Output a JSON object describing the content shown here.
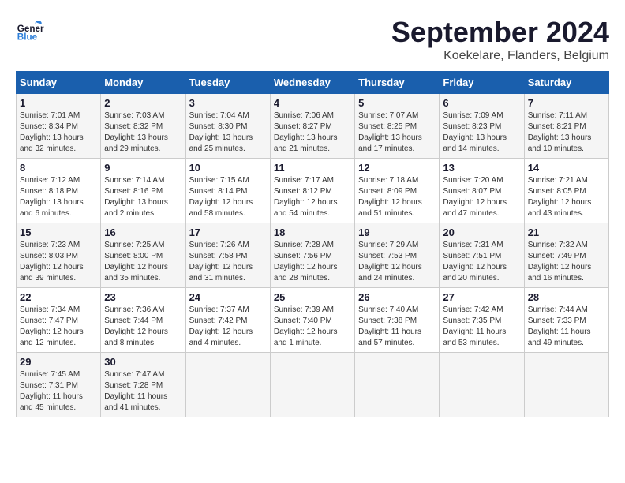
{
  "header": {
    "logo_general": "General",
    "logo_blue": "Blue",
    "month": "September 2024",
    "location": "Koekelare, Flanders, Belgium"
  },
  "weekdays": [
    "Sunday",
    "Monday",
    "Tuesday",
    "Wednesday",
    "Thursday",
    "Friday",
    "Saturday"
  ],
  "weeks": [
    [
      {
        "day": "1",
        "info": "Sunrise: 7:01 AM\nSunset: 8:34 PM\nDaylight: 13 hours\nand 32 minutes."
      },
      {
        "day": "2",
        "info": "Sunrise: 7:03 AM\nSunset: 8:32 PM\nDaylight: 13 hours\nand 29 minutes."
      },
      {
        "day": "3",
        "info": "Sunrise: 7:04 AM\nSunset: 8:30 PM\nDaylight: 13 hours\nand 25 minutes."
      },
      {
        "day": "4",
        "info": "Sunrise: 7:06 AM\nSunset: 8:27 PM\nDaylight: 13 hours\nand 21 minutes."
      },
      {
        "day": "5",
        "info": "Sunrise: 7:07 AM\nSunset: 8:25 PM\nDaylight: 13 hours\nand 17 minutes."
      },
      {
        "day": "6",
        "info": "Sunrise: 7:09 AM\nSunset: 8:23 PM\nDaylight: 13 hours\nand 14 minutes."
      },
      {
        "day": "7",
        "info": "Sunrise: 7:11 AM\nSunset: 8:21 PM\nDaylight: 13 hours\nand 10 minutes."
      }
    ],
    [
      {
        "day": "8",
        "info": "Sunrise: 7:12 AM\nSunset: 8:18 PM\nDaylight: 13 hours\nand 6 minutes."
      },
      {
        "day": "9",
        "info": "Sunrise: 7:14 AM\nSunset: 8:16 PM\nDaylight: 13 hours\nand 2 minutes."
      },
      {
        "day": "10",
        "info": "Sunrise: 7:15 AM\nSunset: 8:14 PM\nDaylight: 12 hours\nand 58 minutes."
      },
      {
        "day": "11",
        "info": "Sunrise: 7:17 AM\nSunset: 8:12 PM\nDaylight: 12 hours\nand 54 minutes."
      },
      {
        "day": "12",
        "info": "Sunrise: 7:18 AM\nSunset: 8:09 PM\nDaylight: 12 hours\nand 51 minutes."
      },
      {
        "day": "13",
        "info": "Sunrise: 7:20 AM\nSunset: 8:07 PM\nDaylight: 12 hours\nand 47 minutes."
      },
      {
        "day": "14",
        "info": "Sunrise: 7:21 AM\nSunset: 8:05 PM\nDaylight: 12 hours\nand 43 minutes."
      }
    ],
    [
      {
        "day": "15",
        "info": "Sunrise: 7:23 AM\nSunset: 8:03 PM\nDaylight: 12 hours\nand 39 minutes."
      },
      {
        "day": "16",
        "info": "Sunrise: 7:25 AM\nSunset: 8:00 PM\nDaylight: 12 hours\nand 35 minutes."
      },
      {
        "day": "17",
        "info": "Sunrise: 7:26 AM\nSunset: 7:58 PM\nDaylight: 12 hours\nand 31 minutes."
      },
      {
        "day": "18",
        "info": "Sunrise: 7:28 AM\nSunset: 7:56 PM\nDaylight: 12 hours\nand 28 minutes."
      },
      {
        "day": "19",
        "info": "Sunrise: 7:29 AM\nSunset: 7:53 PM\nDaylight: 12 hours\nand 24 minutes."
      },
      {
        "day": "20",
        "info": "Sunrise: 7:31 AM\nSunset: 7:51 PM\nDaylight: 12 hours\nand 20 minutes."
      },
      {
        "day": "21",
        "info": "Sunrise: 7:32 AM\nSunset: 7:49 PM\nDaylight: 12 hours\nand 16 minutes."
      }
    ],
    [
      {
        "day": "22",
        "info": "Sunrise: 7:34 AM\nSunset: 7:47 PM\nDaylight: 12 hours\nand 12 minutes."
      },
      {
        "day": "23",
        "info": "Sunrise: 7:36 AM\nSunset: 7:44 PM\nDaylight: 12 hours\nand 8 minutes."
      },
      {
        "day": "24",
        "info": "Sunrise: 7:37 AM\nSunset: 7:42 PM\nDaylight: 12 hours\nand 4 minutes."
      },
      {
        "day": "25",
        "info": "Sunrise: 7:39 AM\nSunset: 7:40 PM\nDaylight: 12 hours\nand 1 minute."
      },
      {
        "day": "26",
        "info": "Sunrise: 7:40 AM\nSunset: 7:38 PM\nDaylight: 11 hours\nand 57 minutes."
      },
      {
        "day": "27",
        "info": "Sunrise: 7:42 AM\nSunset: 7:35 PM\nDaylight: 11 hours\nand 53 minutes."
      },
      {
        "day": "28",
        "info": "Sunrise: 7:44 AM\nSunset: 7:33 PM\nDaylight: 11 hours\nand 49 minutes."
      }
    ],
    [
      {
        "day": "29",
        "info": "Sunrise: 7:45 AM\nSunset: 7:31 PM\nDaylight: 11 hours\nand 45 minutes."
      },
      {
        "day": "30",
        "info": "Sunrise: 7:47 AM\nSunset: 7:28 PM\nDaylight: 11 hours\nand 41 minutes."
      },
      {
        "day": "",
        "info": ""
      },
      {
        "day": "",
        "info": ""
      },
      {
        "day": "",
        "info": ""
      },
      {
        "day": "",
        "info": ""
      },
      {
        "day": "",
        "info": ""
      }
    ]
  ]
}
